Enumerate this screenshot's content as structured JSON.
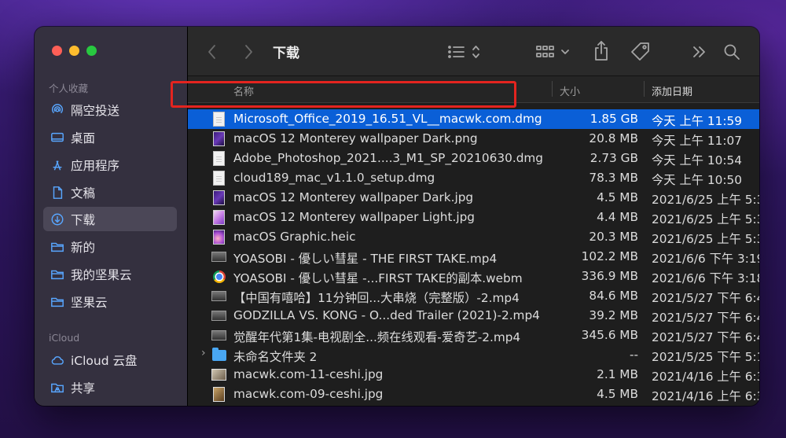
{
  "sidebar": {
    "favorites_heading": "个人收藏",
    "favorites": [
      {
        "label": "隔空投送",
        "icon": "airdrop-icon"
      },
      {
        "label": "桌面",
        "icon": "desktop-icon"
      },
      {
        "label": "应用程序",
        "icon": "applications-icon"
      },
      {
        "label": "文稿",
        "icon": "document-icon"
      },
      {
        "label": "下载",
        "icon": "download-icon",
        "active": true
      },
      {
        "label": "新的",
        "icon": "folder-icon"
      },
      {
        "label": "我的坚果云",
        "icon": "folder-icon"
      },
      {
        "label": "坚果云",
        "icon": "folder-icon"
      }
    ],
    "icloud_heading": "iCloud",
    "icloud": [
      {
        "label": "iCloud 云盘",
        "icon": "cloud-icon"
      },
      {
        "label": "共享",
        "icon": "shared-folder-icon"
      }
    ]
  },
  "toolbar": {
    "title": "下载"
  },
  "columns": {
    "name": "名称",
    "size": "大小",
    "date": "添加日期"
  },
  "files": [
    {
      "name": "Microsoft_Office_2019_16.51_VL__macwk.com.dmg",
      "size": "1.85 GB",
      "date": "今天 上午 11:59",
      "icon": "dmg-file-icon",
      "selected": true
    },
    {
      "name": "macOS 12 Monterey wallpaper Dark.png",
      "size": "20.8 MB",
      "date": "今天 上午 11:07",
      "icon": "image-file-icon"
    },
    {
      "name": "Adobe_Photoshop_2021....3_M1_SP_20210630.dmg",
      "size": "2.73 GB",
      "date": "今天 上午 10:54",
      "icon": "dmg-file-icon"
    },
    {
      "name": "cloud189_mac_v1.1.0_setup.dmg",
      "size": "78.3 MB",
      "date": "今天 上午 10:50",
      "icon": "dmg-file-icon"
    },
    {
      "name": "macOS 12 Monterey wallpaper Dark.jpg",
      "size": "4.5 MB",
      "date": "2021/6/25 上午 5:3",
      "icon": "image-file-icon"
    },
    {
      "name": "macOS 12 Monterey wallpaper Light.jpg",
      "size": "4.4 MB",
      "date": "2021/6/25 上午 5:3",
      "icon": "image-file-icon"
    },
    {
      "name": "macOS Graphic.heic",
      "size": "20.3 MB",
      "date": "2021/6/25 上午 5:3",
      "icon": "image-file-icon"
    },
    {
      "name": "YOASOBI - 優しい彗星  - THE FIRST TAKE.mp4",
      "size": "102.2 MB",
      "date": "2021/6/6 下午 3:19",
      "icon": "video-file-icon"
    },
    {
      "name": "YOASOBI - 優しい彗星  -...FIRST TAKE的副本.webm",
      "size": "336.9 MB",
      "date": "2021/6/6 下午 3:18",
      "icon": "chrome-file-icon"
    },
    {
      "name": "【中国有嘻哈】11分钟回...大串烧（完整版）-2.mp4",
      "size": "84.6 MB",
      "date": "2021/5/27 下午 6:4",
      "icon": "video-file-icon"
    },
    {
      "name": "GODZILLA VS. KONG - O...ded Trailer (2021)-2.mp4",
      "size": "39.2 MB",
      "date": "2021/5/27 下午 6:4",
      "icon": "video-file-icon"
    },
    {
      "name": "觉醒年代第1集-电视剧全...频在线观看-爱奇艺-2.mp4",
      "size": "345.6 MB",
      "date": "2021/5/27 下午 6:4",
      "icon": "video-file-icon"
    },
    {
      "name": "未命名文件夹 2",
      "size": "--",
      "date": "2021/5/25 下午 5:1",
      "icon": "folder-icon",
      "expandable": true
    },
    {
      "name": "macwk.com-11-ceshi.jpg",
      "size": "2.1 MB",
      "date": "2021/4/16 上午 6:3",
      "icon": "photo-file-icon"
    },
    {
      "name": "macwk.com-09-ceshi.jpg",
      "size": "4.5 MB",
      "date": "2021/4/16 上午 6:3",
      "icon": "photo-file-icon"
    }
  ],
  "colors": {
    "selection": "#0a5fd7",
    "highlight_box": "#e4241f",
    "sidebar_bg": "#34303f",
    "window_bg": "#1e1e1e"
  }
}
